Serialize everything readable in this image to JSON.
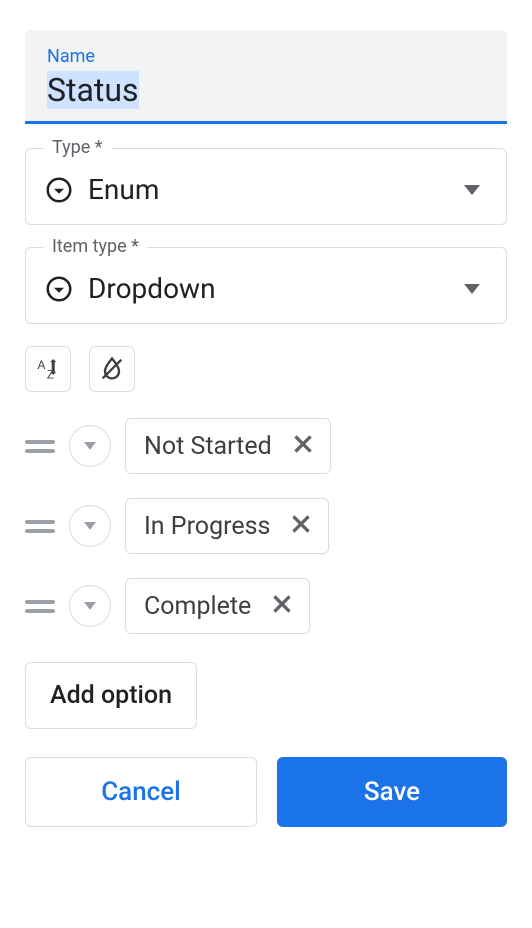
{
  "name_field": {
    "label": "Name",
    "value": "Status"
  },
  "type_field": {
    "label": "Type *",
    "value": "Enum"
  },
  "item_type_field": {
    "label": "Item type *",
    "value": "Dropdown"
  },
  "options": [
    {
      "label": "Not Started"
    },
    {
      "label": "In Progress"
    },
    {
      "label": "Complete"
    }
  ],
  "add_option_label": "Add option",
  "footer": {
    "cancel": "Cancel",
    "save": "Save"
  }
}
